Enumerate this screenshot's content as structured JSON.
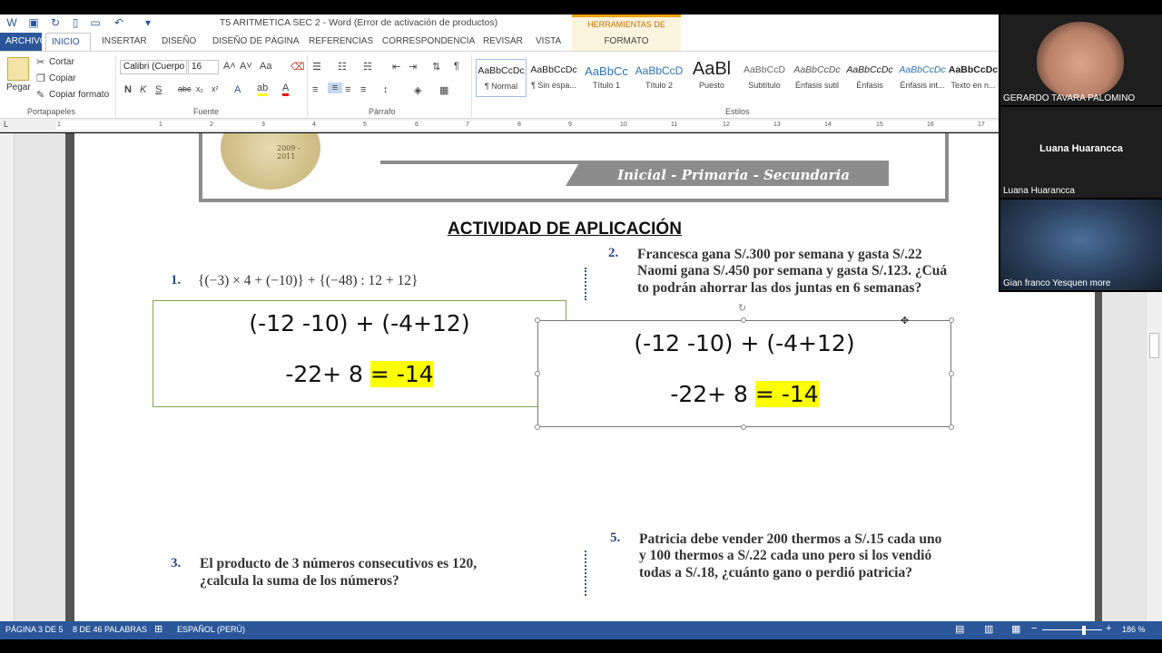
{
  "window": {
    "title": "T5 ARITMETICA SEC 2 - Word (Error de activación de productos)",
    "context_tab_group": "HERRAMIENTAS DE DIBUJO"
  },
  "tabs": [
    "ARCHIVO",
    "INICIO",
    "INSERTAR",
    "DISEÑO",
    "DISEÑO DE PÁGINA",
    "REFERENCIAS",
    "CORRESPONDENCIA",
    "REVISAR",
    "VISTA",
    "FORMATO"
  ],
  "ribbon": {
    "clipboard": {
      "paste": "Pegar",
      "cut": "Cortar",
      "copy": "Copiar",
      "format_painter": "Copiar formato",
      "label": "Portapapeles"
    },
    "font": {
      "family": "Calibri (Cuerpo",
      "size": "16",
      "label": "Fuente"
    },
    "paragraph": {
      "label": "Párrafo"
    },
    "styles": {
      "label": "Estilos",
      "items": [
        {
          "sample": "AaBbCcDc",
          "name": "¶ Normal"
        },
        {
          "sample": "AaBbCcDc",
          "name": "¶ Sin espa..."
        },
        {
          "sample": "AaBbCc",
          "name": "Título 1"
        },
        {
          "sample": "AaBbCcD",
          "name": "Título 2"
        },
        {
          "sample": "AaBl",
          "name": "Puesto"
        },
        {
          "sample": "AaBbCcD",
          "name": "Subtítulo"
        },
        {
          "sample": "AaBbCcDc",
          "name": "Énfasis sutil"
        },
        {
          "sample": "AaBbCcDc",
          "name": "Énfasis"
        },
        {
          "sample": "AaBbCcDc",
          "name": "Énfasis int..."
        },
        {
          "sample": "AaBbCcDc",
          "name": "Texto en n..."
        }
      ]
    }
  },
  "ruler_ticks": [
    "1",
    "1",
    "2",
    "3",
    "4",
    "5",
    "6",
    "7",
    "8",
    "9",
    "10",
    "11",
    "12",
    "13",
    "14",
    "15",
    "16",
    "17"
  ],
  "document": {
    "banner_text": "Inicial - Primaria - Secundaria",
    "seal_year": "2009 - 2011",
    "heading": "ACTIVIDAD DE APLICACIÓN",
    "q1_num": "1.",
    "q1_text": "{(−3) × 4 + (−10)} + {(−48) : 12 + 12}",
    "q2_num": "2.",
    "q2_text_1": "Francesca gana S/.300 por semana y gasta S/.22",
    "q2_text_2": "Naomi gana S/.450 por semana y gasta S/.123. ¿Cuá",
    "q2_text_3": "to podrán ahorrar las dos juntas en 6 semanas?",
    "q3_num": "3.",
    "q3_text_1": "El producto de 3 números consecutivos es 120,",
    "q3_text_2": "¿calcula la suma de los números?",
    "q5_num": "5.",
    "q5_text_1": "Patricia debe vender 200 thermos a S/.15 cada uno",
    "q5_text_2": "y 100 thermos a S/.22 cada uno pero si los vendió",
    "q5_text_3": "todas a S/.18, ¿cuánto gano o perdió patricia?",
    "box_a": {
      "line1": "(-12 -10) + (-4+12)",
      "line2_pre": "-22+ 8 ",
      "line2_hl": "= -14"
    },
    "box_b": {
      "line1": "(-12 -10) + (-4+12)",
      "line2_pre": "-22+ 8 ",
      "line2_hl": "= -14"
    }
  },
  "status": {
    "page": "PÁGINA 3 DE 5",
    "words": "8 DE 46 PALABRAS",
    "language": "ESPAÑOL (PERÚ)",
    "zoom": "186 %"
  },
  "participants": [
    {
      "name": "GERARDO TAVARA PALOMINO"
    },
    {
      "name": "Luana Huarancca",
      "center_label": "Luana Huarancca"
    },
    {
      "name": "Gian franco Yesquen more"
    }
  ]
}
